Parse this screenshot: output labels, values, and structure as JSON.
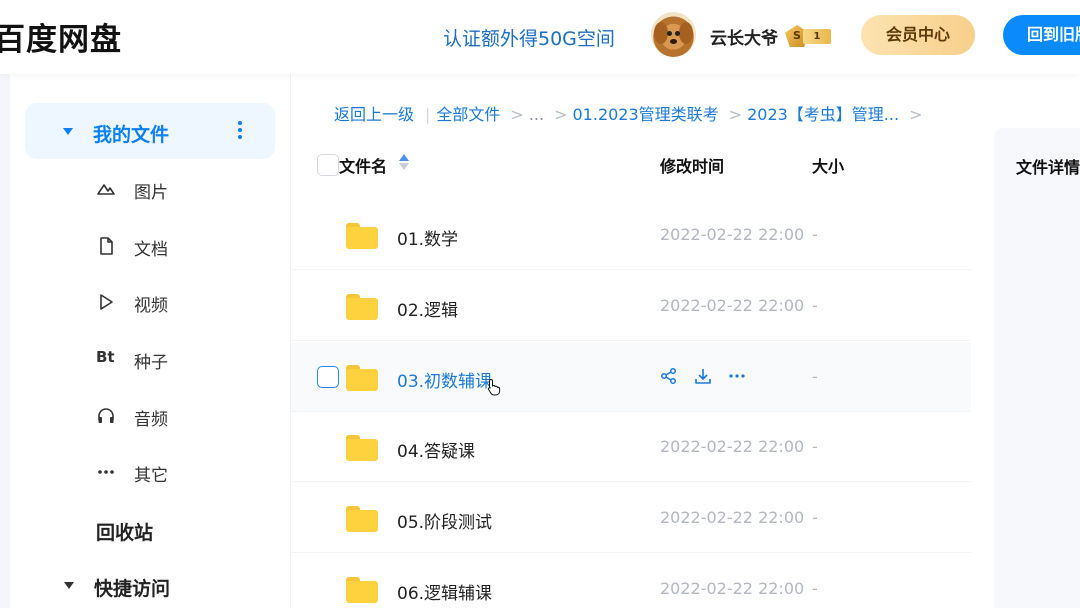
{
  "header": {
    "logo": "百度网盘",
    "promo": "认证额外得50G空间",
    "username": "云长大爷",
    "vip_badge": {
      "tier": "S",
      "level": "1"
    },
    "member_center": "会员中心",
    "old_version": "回到旧版"
  },
  "sidebar": {
    "my_files": "我的文件",
    "items": [
      {
        "icon": "image-icon",
        "label": "图片"
      },
      {
        "icon": "document-icon",
        "label": "文档"
      },
      {
        "icon": "video-icon",
        "label": "视频"
      },
      {
        "icon": "torrent-icon",
        "icon_text": "Bt",
        "label": "种子"
      },
      {
        "icon": "headphones-icon",
        "label": "音频"
      },
      {
        "icon": "more-icon",
        "label": "其它"
      }
    ],
    "recycle_bin": "回收站",
    "quick_access": "快捷访问"
  },
  "breadcrumb": {
    "back": "返回上一级",
    "all_files": "全部文件",
    "ellipsis": "...",
    "level1": "01.2023管理类联考",
    "level2": "2023【考虫】管理..."
  },
  "table": {
    "headers": {
      "name": "文件名",
      "modified": "修改时间",
      "size": "大小"
    },
    "rows": [
      {
        "name": "01.数学",
        "modified": "2022-02-22 22:00",
        "size": "-"
      },
      {
        "name": "02.逻辑",
        "modified": "2022-02-22 22:00",
        "size": "-"
      },
      {
        "name": "03.初数辅课",
        "modified": "",
        "size": "-",
        "hovered": true
      },
      {
        "name": "04.答疑课",
        "modified": "2022-02-22 22:00",
        "size": "-"
      },
      {
        "name": "05.阶段测试",
        "modified": "2022-02-22 22:00",
        "size": "-"
      },
      {
        "name": "06.逻辑辅课",
        "modified": "2022-02-22 22:00",
        "size": "-"
      }
    ]
  },
  "detail_panel": {
    "title": "文件详情"
  },
  "colors": {
    "accent": "#0a80f5",
    "link": "#1a7ad9",
    "folder": "#fdd23e"
  }
}
